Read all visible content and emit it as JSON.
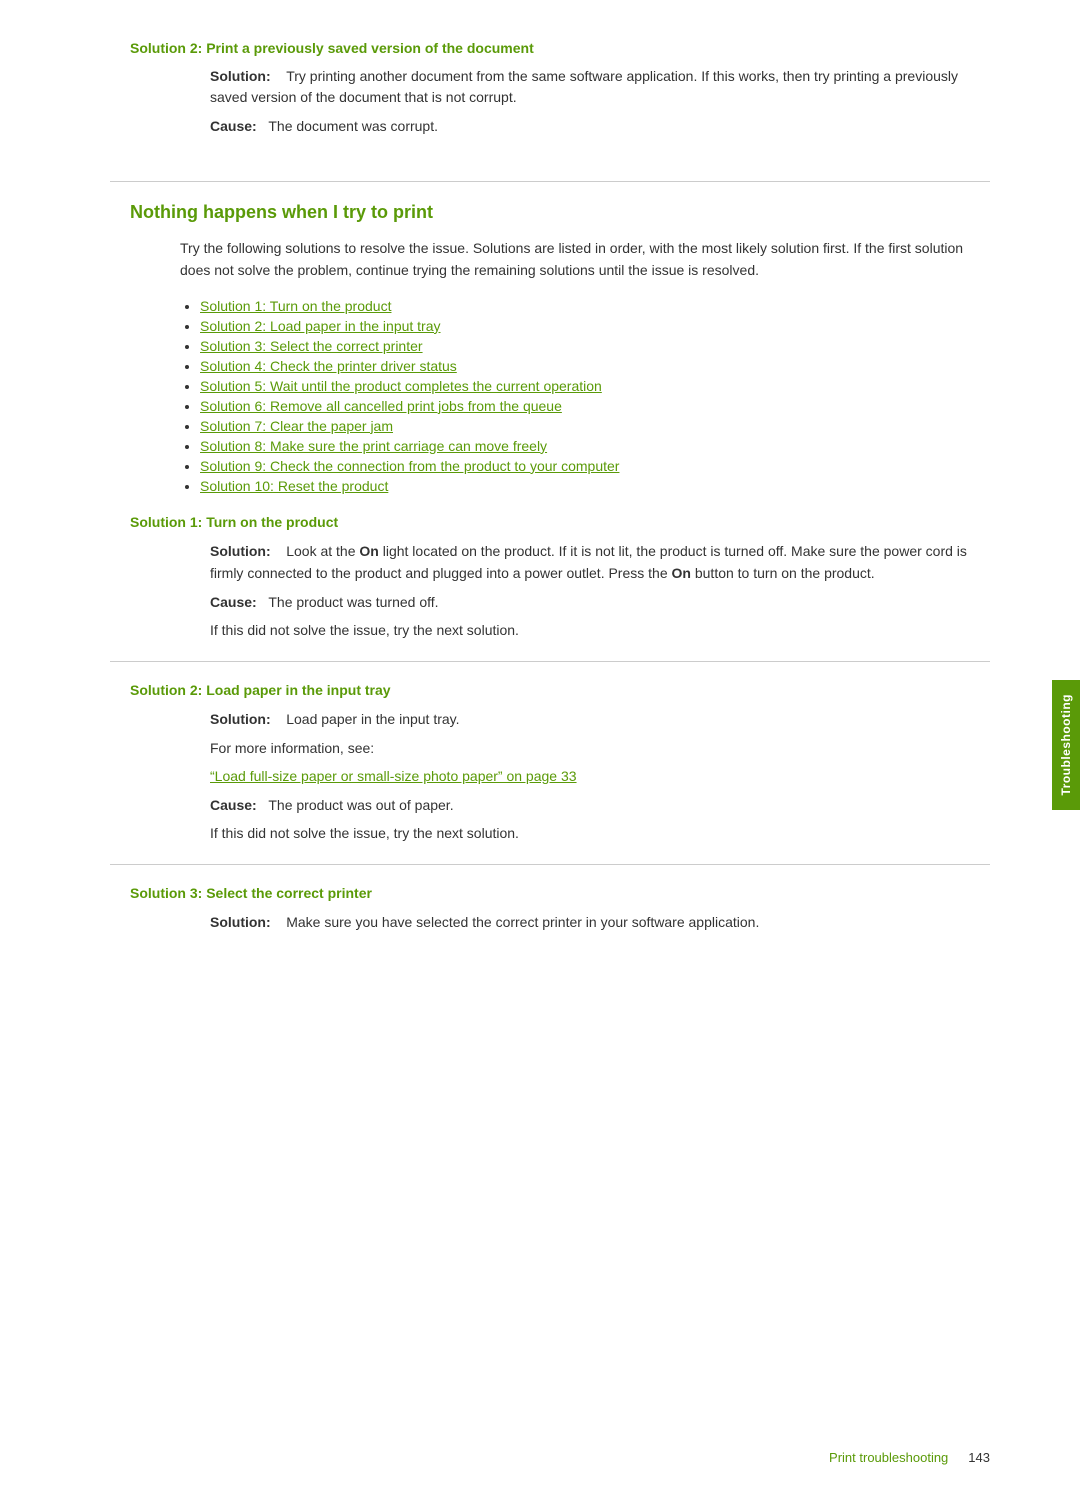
{
  "page": {
    "footer": {
      "label": "Print troubleshooting",
      "page_number": "143"
    }
  },
  "side_tab": {
    "label": "Troubleshooting"
  },
  "top_section": {
    "heading": "Solution 2: Print a previously saved version of the document",
    "solution_label": "Solution:",
    "solution_text": "Try printing another document from the same software application. If this works, then try printing a previously saved version of the document that is not corrupt.",
    "cause_label": "Cause:",
    "cause_text": "The document was corrupt."
  },
  "main_section": {
    "heading": "Nothing happens when I try to print",
    "intro": "Try the following solutions to resolve the issue. Solutions are listed in order, with the most likely solution first. If the first solution does not solve the problem, continue trying the remaining solutions until the issue is resolved.",
    "links": [
      "Solution 1: Turn on the product",
      "Solution 2: Load paper in the input tray",
      "Solution 3: Select the correct printer",
      "Solution 4: Check the printer driver status",
      "Solution 5: Wait until the product completes the current operation",
      "Solution 6: Remove all cancelled print jobs from the queue",
      "Solution 7: Clear the paper jam",
      "Solution 8: Make sure the print carriage can move freely",
      "Solution 9: Check the connection from the product to your computer",
      "Solution 10: Reset the product"
    ]
  },
  "solution1": {
    "heading": "Solution 1: Turn on the product",
    "solution_label": "Solution:",
    "solution_text_part1": "Look at the ",
    "solution_bold1": "On",
    "solution_text_part2": " light located on the product. If it is not lit, the product is turned off. Make sure the power cord is firmly connected to the product and plugged into a power outlet. Press the ",
    "solution_bold2": "On",
    "solution_text_part3": " button to turn on the product.",
    "cause_label": "Cause:",
    "cause_text": "The product was turned off.",
    "next_solution_text": "If this did not solve the issue, try the next solution."
  },
  "solution2": {
    "heading": "Solution 2: Load paper in the input tray",
    "solution_label": "Solution:",
    "solution_text": "Load paper in the input tray.",
    "more_info_text": "For more information, see:",
    "link_text": "“Load full-size paper or small-size photo paper” on page 33",
    "cause_label": "Cause:",
    "cause_text": "The product was out of paper.",
    "next_solution_text": "If this did not solve the issue, try the next solution."
  },
  "solution3": {
    "heading": "Solution 3: Select the correct printer",
    "solution_label": "Solution:",
    "solution_text": "Make sure you have selected the correct printer in your software application."
  }
}
